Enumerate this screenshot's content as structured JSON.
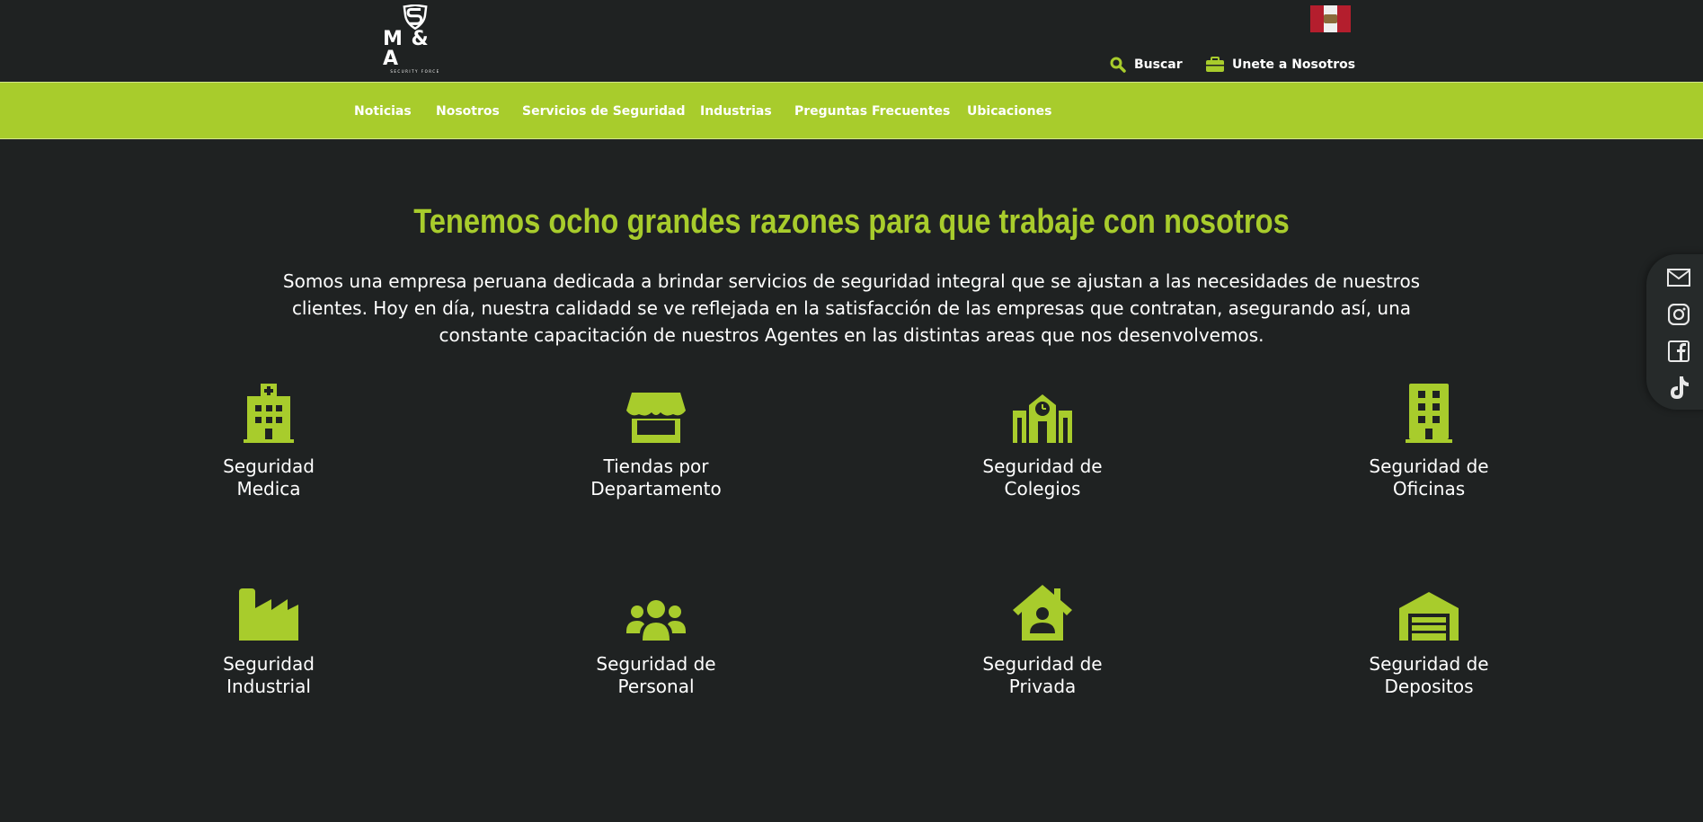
{
  "header": {
    "logo_text": "M & A",
    "logo_subtext": "SECURITY FORCE",
    "search_label": "Buscar",
    "join_label": "Unete a Nosotros"
  },
  "nav": {
    "items": [
      {
        "label": "Noticias"
      },
      {
        "label": "Nosotros"
      },
      {
        "label": "Servicios de Seguridad"
      },
      {
        "label": "Industrias"
      },
      {
        "label": "Preguntas Frecuentes"
      },
      {
        "label": "Ubicaciones"
      }
    ]
  },
  "hero": {
    "title": "Tenemos ocho grandes razones para que trabaje con nosotros",
    "intro": "Somos una empresa peruana dedicada a brindar servicios de seguridad integral que se ajustan a las necesidades de nuestros clientes. Hoy en día, nuestra calidadd se ve reflejada en la satisfacción de las empresas que contratan, asegurando así, una constante capacitación de nuestros Agentes en las distintas areas que nos desenvolvemos."
  },
  "services": [
    {
      "line1": "Seguridad",
      "line2": "Medica",
      "icon": "hospital-icon"
    },
    {
      "line1": "Tiendas por",
      "line2": "Departamento",
      "icon": "store-icon"
    },
    {
      "line1": "Seguridad de",
      "line2": "Colegios",
      "icon": "school-icon"
    },
    {
      "line1": "Seguridad de",
      "line2": "Oficinas",
      "icon": "office-building-icon"
    },
    {
      "line1": "Seguridad",
      "line2": "Industrial",
      "icon": "factory-icon"
    },
    {
      "line1": "Seguridad de",
      "line2": "Personal",
      "icon": "people-group-icon"
    },
    {
      "line1": "Seguridad de",
      "line2": "Privada",
      "icon": "house-user-icon"
    },
    {
      "line1": "Seguridad de",
      "line2": "Depositos",
      "icon": "warehouse-icon"
    }
  ],
  "social": [
    "mail-icon",
    "instagram-icon",
    "facebook-icon",
    "tiktok-icon"
  ],
  "colors": {
    "background": "#1f2222",
    "accent": "#a8cc2c",
    "text": "#ffffff"
  }
}
